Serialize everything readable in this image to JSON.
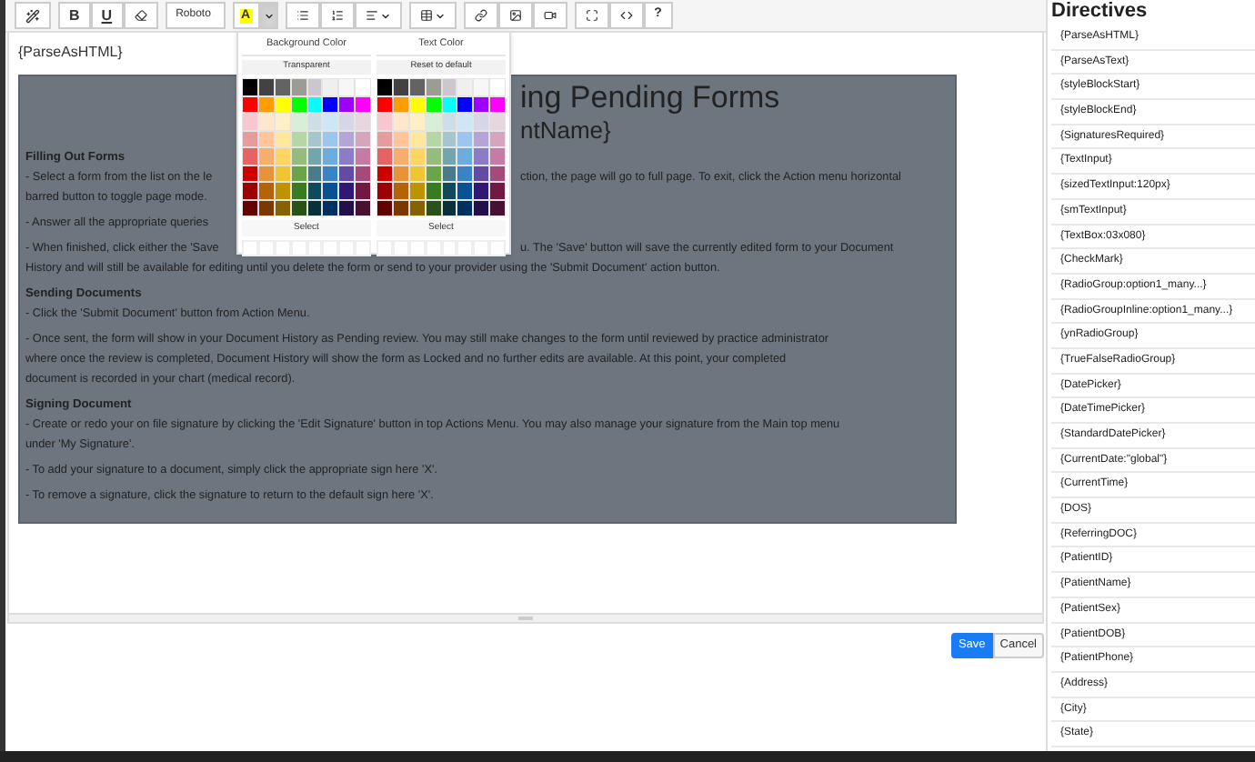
{
  "toolbar": {
    "bold": "B",
    "underline": "U",
    "font": "Roboto",
    "highlight_letter": "A",
    "help": "?",
    "color_menu_open": true
  },
  "color_menu": [
    {
      "title": "Background Color",
      "reset": "Transparent",
      "select": "Select",
      "swatches": [
        {
          "color": "#000000"
        },
        {
          "color": "#424242"
        },
        {
          "color": "#636363"
        },
        {
          "color": "#9c9c94"
        },
        {
          "color": "#cec6ce"
        },
        {
          "color": "#efefef"
        },
        {
          "color": "#f7f7f7"
        },
        {
          "color": "#ffffff"
        },
        {
          "color": "#ff0000"
        },
        {
          "color": "#ff9c00"
        },
        {
          "color": "#ffff00"
        },
        {
          "color": "#00ff00"
        },
        {
          "color": "#00ffff"
        },
        {
          "color": "#0000ff"
        },
        {
          "color": "#9c00ff"
        },
        {
          "color": "#ff00ff"
        },
        {
          "color": "#f7c6ce"
        },
        {
          "color": "#ffe7ce"
        },
        {
          "color": "#ffefc6"
        },
        {
          "color": "#d6efd6"
        },
        {
          "color": "#cedee7"
        },
        {
          "color": "#cee7f7"
        },
        {
          "color": "#d6d6e7"
        },
        {
          "color": "#e7d6de"
        },
        {
          "color": "#e79c9c"
        },
        {
          "color": "#ffc69c"
        },
        {
          "color": "#ffe79c"
        },
        {
          "color": "#b5d6a5"
        },
        {
          "color": "#a5c6ce"
        },
        {
          "color": "#9cc6ef"
        },
        {
          "color": "#b5a5d6"
        },
        {
          "color": "#d6a5bd"
        },
        {
          "color": "#e76363"
        },
        {
          "color": "#f7ad6b"
        },
        {
          "color": "#ffd663"
        },
        {
          "color": "#94bd7b"
        },
        {
          "color": "#73a5ad"
        },
        {
          "color": "#6badde"
        },
        {
          "color": "#8c7bc6"
        },
        {
          "color": "#c67ba5"
        },
        {
          "color": "#ce0000"
        },
        {
          "color": "#e79439"
        },
        {
          "color": "#efc631"
        },
        {
          "color": "#6ba54a"
        },
        {
          "color": "#4a7b8c"
        },
        {
          "color": "#3984c6"
        },
        {
          "color": "#634aa5"
        },
        {
          "color": "#a54a7b"
        },
        {
          "color": "#9c0000"
        },
        {
          "color": "#b56308"
        },
        {
          "color": "#bd9400"
        },
        {
          "color": "#397b21"
        },
        {
          "color": "#104a5a"
        },
        {
          "color": "#085294"
        },
        {
          "color": "#311873"
        },
        {
          "color": "#731842"
        },
        {
          "color": "#630000"
        },
        {
          "color": "#7b3900"
        },
        {
          "color": "#846300"
        },
        {
          "color": "#295218"
        },
        {
          "color": "#083139"
        },
        {
          "color": "#003163"
        },
        {
          "color": "#21104a"
        },
        {
          "color": "#4a1031"
        }
      ]
    },
    {
      "title": "Text Color",
      "reset": "Reset to default",
      "select": "Select",
      "swatches": [
        {
          "color": "#000000"
        },
        {
          "color": "#424242"
        },
        {
          "color": "#636363"
        },
        {
          "color": "#9c9c94"
        },
        {
          "color": "#cec6ce"
        },
        {
          "color": "#efefef"
        },
        {
          "color": "#f7f7f7"
        },
        {
          "color": "#ffffff"
        },
        {
          "color": "#ff0000"
        },
        {
          "color": "#ff9c00"
        },
        {
          "color": "#ffff00"
        },
        {
          "color": "#00ff00"
        },
        {
          "color": "#00ffff"
        },
        {
          "color": "#0000ff"
        },
        {
          "color": "#9c00ff"
        },
        {
          "color": "#ff00ff"
        },
        {
          "color": "#f7c6ce"
        },
        {
          "color": "#ffe7ce"
        },
        {
          "color": "#ffefc6"
        },
        {
          "color": "#d6efd6"
        },
        {
          "color": "#cedee7"
        },
        {
          "color": "#cee7f7"
        },
        {
          "color": "#d6d6e7"
        },
        {
          "color": "#e7d6de"
        },
        {
          "color": "#e79c9c"
        },
        {
          "color": "#ffc69c"
        },
        {
          "color": "#ffe79c"
        },
        {
          "color": "#b5d6a5"
        },
        {
          "color": "#a5c6ce"
        },
        {
          "color": "#9cc6ef"
        },
        {
          "color": "#b5a5d6"
        },
        {
          "color": "#d6a5bd"
        },
        {
          "color": "#e76363"
        },
        {
          "color": "#f7ad6b"
        },
        {
          "color": "#ffd663"
        },
        {
          "color": "#94bd7b"
        },
        {
          "color": "#73a5ad"
        },
        {
          "color": "#6badde"
        },
        {
          "color": "#8c7bc6"
        },
        {
          "color": "#c67ba5"
        },
        {
          "color": "#ce0000"
        },
        {
          "color": "#e79439"
        },
        {
          "color": "#efc631"
        },
        {
          "color": "#6ba54a"
        },
        {
          "color": "#4a7b8c"
        },
        {
          "color": "#3984c6"
        },
        {
          "color": "#634aa5"
        },
        {
          "color": "#a54a7b"
        },
        {
          "color": "#9c0000"
        },
        {
          "color": "#b56308"
        },
        {
          "color": "#bd9400"
        },
        {
          "color": "#397b21"
        },
        {
          "color": "#104a5a"
        },
        {
          "color": "#085294"
        },
        {
          "color": "#311873"
        },
        {
          "color": "#731842"
        },
        {
          "color": "#630000"
        },
        {
          "color": "#7b3900"
        },
        {
          "color": "#846300"
        },
        {
          "color": "#295218"
        },
        {
          "color": "#083139"
        },
        {
          "color": "#003163"
        },
        {
          "color": "#21104a"
        },
        {
          "color": "#4a1031"
        }
      ]
    }
  ],
  "editor": {
    "first_line": "{ParseAsHTML}",
    "document": [
      {
        "kind": "title",
        "lines": [
          {
            "right": "ing Pending Forms"
          }
        ]
      },
      {
        "kind": "subtitle",
        "lines": [
          {
            "right": "ntName}"
          }
        ]
      },
      {
        "kind": "section",
        "heading": "Filling Out Forms",
        "lines": [
          {
            "left": "- Select a form from the list on the le",
            "right": "ction, the page will go to full page. To exit, click the Action menu horizontal"
          },
          {
            "left": "barred button to toggle page mode."
          }
        ]
      },
      {
        "kind": "para",
        "lines": [
          {
            "left": "- Answer all the appropriate queries"
          }
        ]
      },
      {
        "kind": "para",
        "lines": [
          {
            "left": "- When finished, click either the 'Save",
            "right": "u. The 'Save' button will save the currently edited form to your Document"
          },
          {
            "left": "History and will still be available for editing until you delete the form or send to your provider using the 'Submit Document' action button."
          }
        ]
      },
      {
        "kind": "section",
        "heading": "Sending Documents",
        "lines": [
          {
            "left": "- Click the 'Submit Document' button from Action Menu."
          }
        ]
      },
      {
        "kind": "para",
        "lines": [
          {
            "left": "- Once sent, the form will show in your Document History as Pending review. You may still make changes to the form until reviewed by practice administrator"
          },
          {
            "left": "where once the review is completed, Document History will show the form as Locked and no further edits are available. At this point, your completed"
          },
          {
            "left": "document is recorded in your chart (medical record)."
          }
        ]
      },
      {
        "kind": "section",
        "heading": "Signing Document",
        "lines": [
          {
            "left": "- Create or redo your on file signature by clicking the 'Edit Signature' button in top Actions Menu. You may also manage your signature from the Main top menu"
          },
          {
            "left": "under 'My Signature'."
          }
        ]
      },
      {
        "kind": "para",
        "lines": [
          {
            "left": "- To add your signature to a document, simply click the appropriate sign here 'X'."
          }
        ]
      },
      {
        "kind": "para",
        "lines": [
          {
            "left": "- To remove a signature, click the signature to return to the default sign here 'X'."
          }
        ]
      }
    ]
  },
  "buttons": {
    "save": "Save",
    "cancel": "Cancel"
  },
  "sidebar": {
    "title": "Directives",
    "items": [
      "{ParseAsHTML}",
      "{ParseAsText}",
      "{styleBlockStart}",
      "{styleBlockEnd}",
      "{SignaturesRequired}",
      "{TextInput}",
      "{sizedTextInput:120px}",
      "{smTextInput}",
      "{TextBox:03x080}",
      "{CheckMark}",
      "{RadioGroup:option1_many...}",
      "{RadioGroupInline:option1_many...}",
      "{ynRadioGroup}",
      "{TrueFalseRadioGroup}",
      "{DatePicker}",
      "{DateTimePicker}",
      "{StandardDatePicker}",
      "{CurrentDate:\"global\"}",
      "{CurrentTime}",
      "{DOS}",
      "{ReferringDOC}",
      "{PatientID}",
      "{PatientName}",
      "{PatientSex}",
      "{PatientDOB}",
      "{PatientPhone}",
      "{Address}",
      "{City}",
      "{State}"
    ]
  }
}
